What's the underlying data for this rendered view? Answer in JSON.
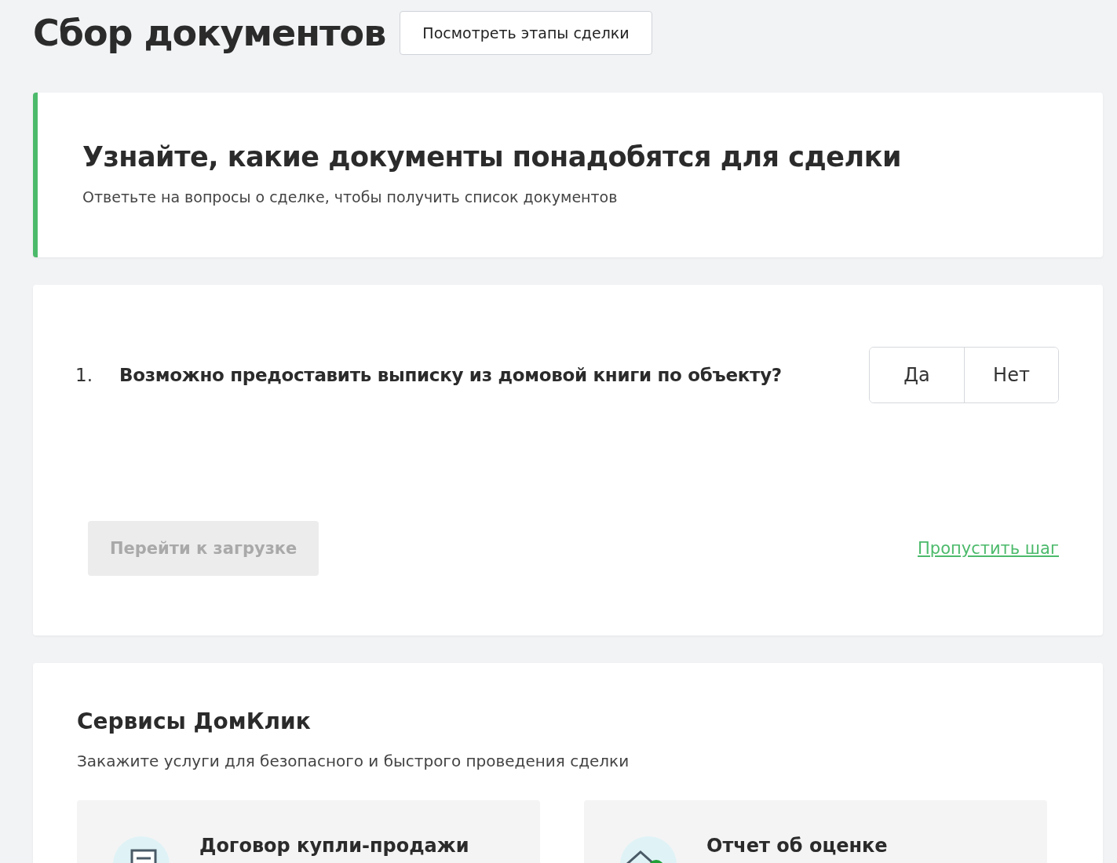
{
  "header": {
    "title": "Сбор документов",
    "stages_button": "Посмотреть этапы сделки"
  },
  "banner": {
    "title": "Узнайте, какие документы понадобятся для сделки",
    "subtitle": "Ответьте на вопросы о сделке, чтобы получить список документов"
  },
  "question": {
    "number": "1.",
    "text": "Возможно предоставить выписку из домовой книги по объекту?",
    "options": [
      {
        "label": "Да",
        "selected": false
      },
      {
        "label": "Нет",
        "selected": false
      }
    ],
    "submit": {
      "label": "Перейти к загрузке",
      "disabled": true
    },
    "skip_link": "Пропустить шаг"
  },
  "services": {
    "title": "Сервисы ДомКлик",
    "subtitle": "Закажите услуги для безопасного и быстрого проведения сделки",
    "cards": [
      {
        "kind": "document",
        "title": "Договор купли-продажи"
      },
      {
        "kind": "valuation",
        "title": "Отчет об оценке"
      }
    ]
  }
}
